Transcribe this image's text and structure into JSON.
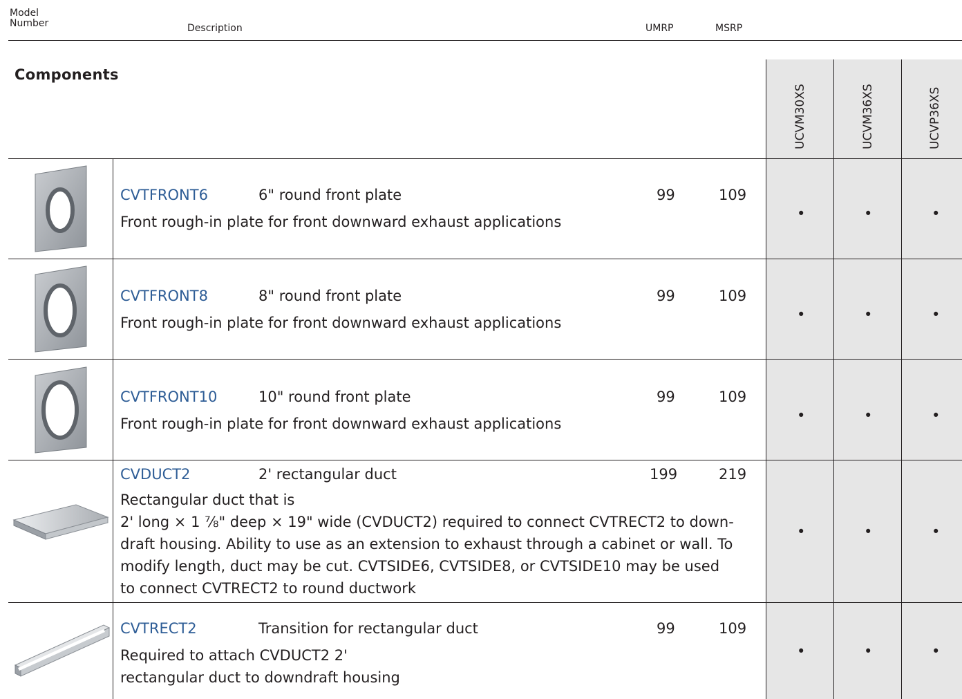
{
  "header": {
    "model_label_1": "Model",
    "model_label_2": "Number",
    "description_label": "Description",
    "umrp_label": "UMRP",
    "msrp_label": "MSRP"
  },
  "section": {
    "title": "Components"
  },
  "models": [
    "UCVM30XS",
    "UCVM36XS",
    "UCVP36XS"
  ],
  "rows": [
    {
      "code": "CVTFRONT6",
      "short": "6\" round front plate",
      "umrp": "99",
      "msrp": "109",
      "desc": "Front rough-in plate for front downward exhaust applications",
      "image": "round-front-plate",
      "compat": [
        "•",
        "•",
        "•"
      ]
    },
    {
      "code": "CVTFRONT8",
      "short": "8\" round front plate",
      "umrp": "99",
      "msrp": "109",
      "desc": "Front rough-in plate for front downward exhaust applications",
      "image": "round-front-plate",
      "compat": [
        "•",
        "•",
        "•"
      ]
    },
    {
      "code": "CVTFRONT10",
      "short": "10\" round front plate",
      "umrp": "99",
      "msrp": "109",
      "desc": "Front rough-in plate for front downward exhaust applications",
      "image": "round-front-plate",
      "compat": [
        "•",
        "•",
        "•"
      ]
    },
    {
      "code": "CVDUCT2",
      "short": "2' rectangular duct",
      "umrp": "199",
      "msrp": "219",
      "desc_lines": [
        "Rectangular duct that is",
        "2' long × 1 ⅞\" deep × 19\" wide (CVDUCT2) required to connect CVTRECT2 to down-",
        "draft housing. Ability to use as an extension to exhaust through a cabinet or wall. To",
        "modify length, duct may be cut. CVTSIDE6, CVTSIDE8, or CVTSIDE10 may be used",
        "to connect CVTRECT2 to round ductwork"
      ],
      "image": "rectangular-duct",
      "compat": [
        "•",
        "•",
        "•"
      ]
    },
    {
      "code": "CVTRECT2",
      "short": "Transition for rectangular duct",
      "umrp": "99",
      "msrp": "109",
      "desc_lines": [
        "Required to attach CVDUCT2 2'",
        "rectangular duct to downdraft housing"
      ],
      "image": "rectangular-transition",
      "compat": [
        "•",
        "•",
        "•"
      ]
    }
  ],
  "colors": {
    "code": "#2e5d96",
    "shade": "#e6e6e6",
    "line": "#231f20"
  }
}
